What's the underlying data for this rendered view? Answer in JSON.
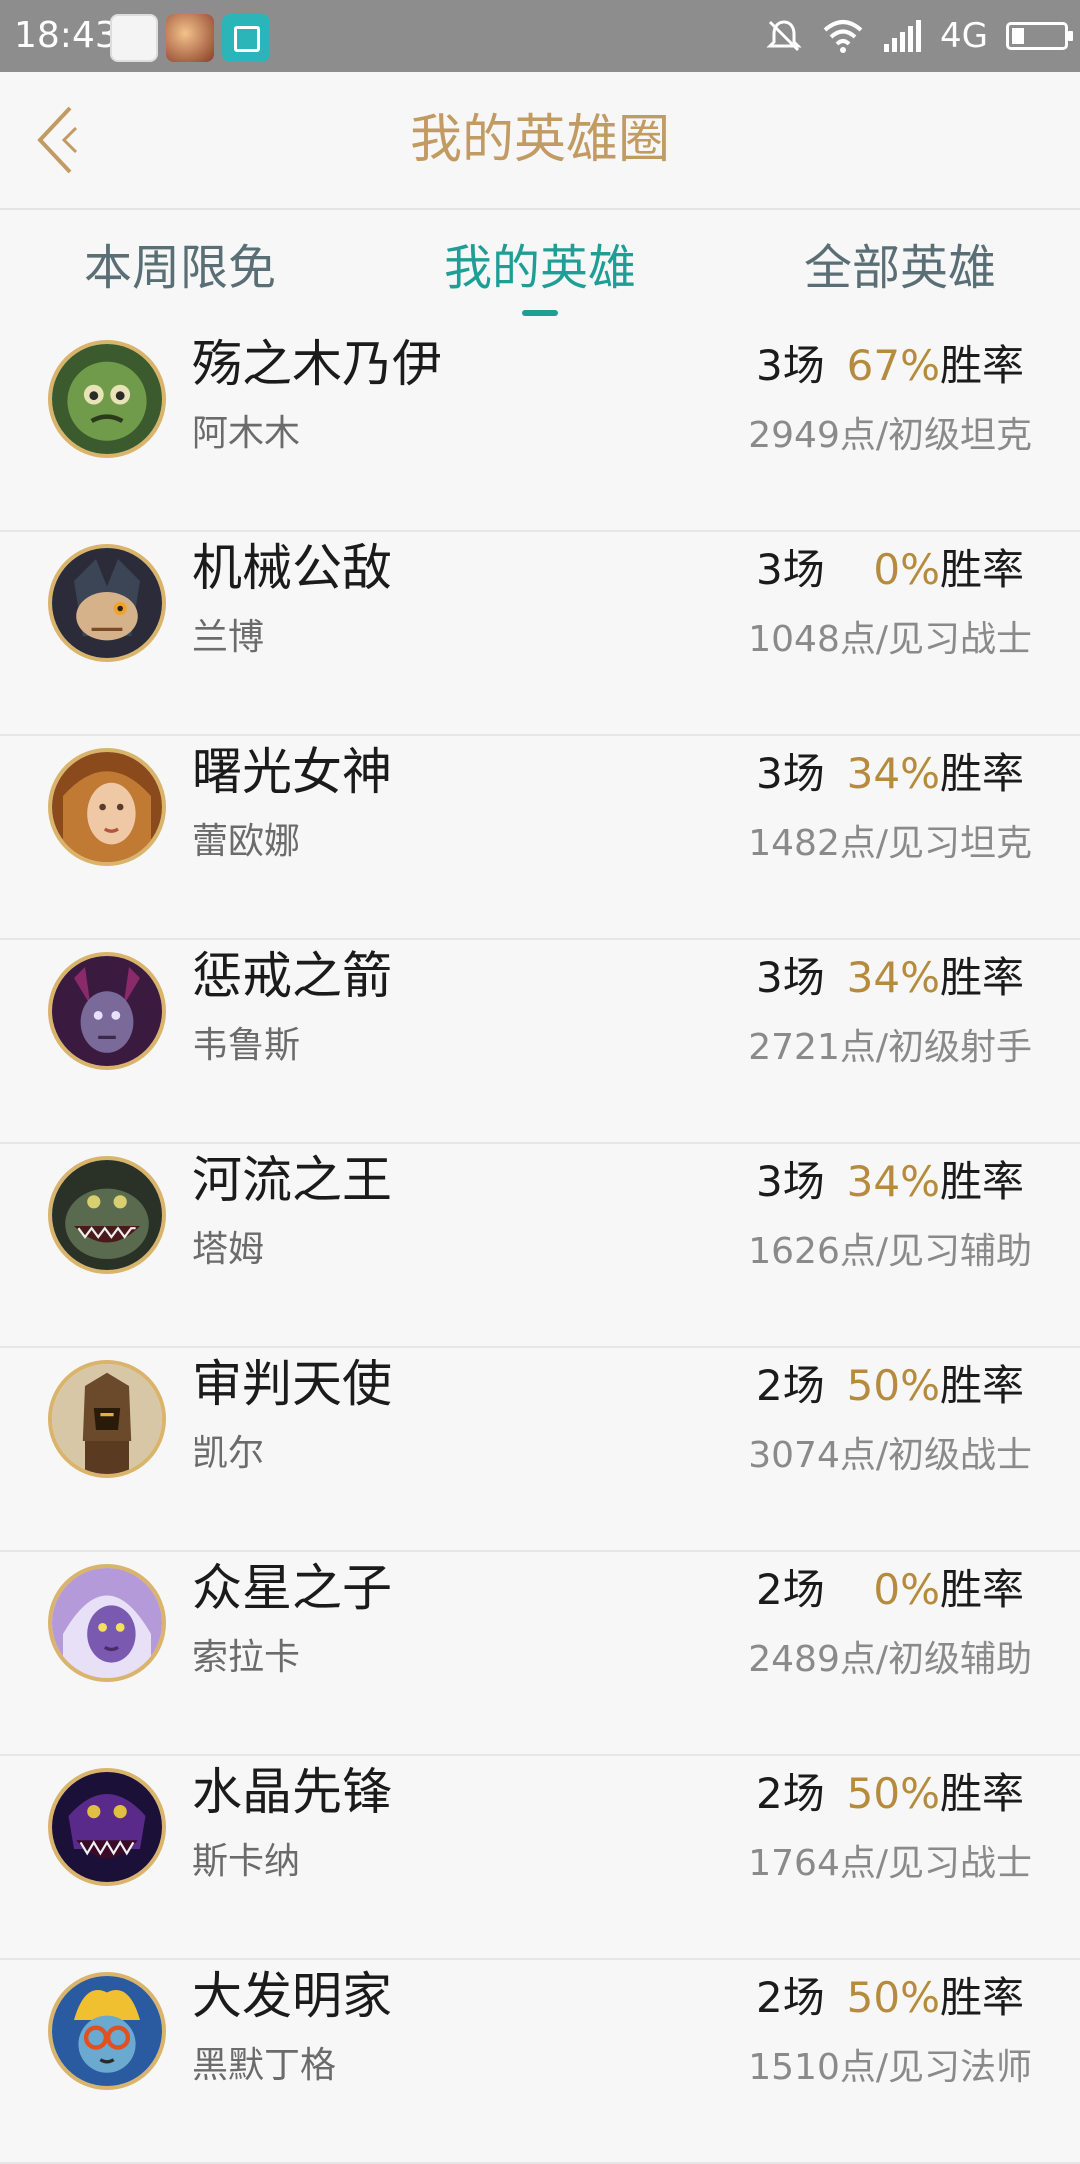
{
  "status_bar": {
    "time": "18:43",
    "network": "4G",
    "icons": [
      "qq-icon",
      "game-icon",
      "scan-icon",
      "mute-icon",
      "wifi-icon",
      "signal-icon",
      "battery-icon"
    ]
  },
  "header": {
    "title": "我的英雄圈",
    "back_icon": "chevron-left-icon"
  },
  "tabs": [
    {
      "label": "本周限免",
      "active": false
    },
    {
      "label": "我的英雄",
      "active": true
    },
    {
      "label": "全部英雄",
      "active": false
    }
  ],
  "heroes": [
    {
      "title": "殇之木乃伊",
      "name": "阿木木",
      "games": "3场",
      "pct": "67%",
      "rate_label": "胜率",
      "points": "2949点/初级坦克"
    },
    {
      "title": "机械公敌",
      "name": "兰博",
      "games": "3场",
      "pct": "0%",
      "rate_label": "胜率",
      "points": "1048点/见习战士"
    },
    {
      "title": "曙光女神",
      "name": "蕾欧娜",
      "games": "3场",
      "pct": "34%",
      "rate_label": "胜率",
      "points": "1482点/见习坦克"
    },
    {
      "title": "惩戒之箭",
      "name": "韦鲁斯",
      "games": "3场",
      "pct": "34%",
      "rate_label": "胜率",
      "points": "2721点/初级射手"
    },
    {
      "title": "河流之王",
      "name": "塔姆",
      "games": "3场",
      "pct": "34%",
      "rate_label": "胜率",
      "points": "1626点/见习辅助"
    },
    {
      "title": "审判天使",
      "name": "凯尔",
      "games": "2场",
      "pct": "50%",
      "rate_label": "胜率",
      "points": "3074点/初级战士"
    },
    {
      "title": "众星之子",
      "name": "索拉卡",
      "games": "2场",
      "pct": "0%",
      "rate_label": "胜率",
      "points": "2489点/初级辅助"
    },
    {
      "title": "水晶先锋",
      "name": "斯卡纳",
      "games": "2场",
      "pct": "50%",
      "rate_label": "胜率",
      "points": "1764点/见习战士"
    },
    {
      "title": "大发明家",
      "name": "黑默丁格",
      "games": "2场",
      "pct": "50%",
      "rate_label": "胜率",
      "points": "1510点/见习法师"
    }
  ],
  "colors": {
    "accent_gold": "#c19b62",
    "accent_teal": "#1f9e96",
    "pct_gold": "#b68b3d",
    "status_bar": "#8d8d8d"
  }
}
